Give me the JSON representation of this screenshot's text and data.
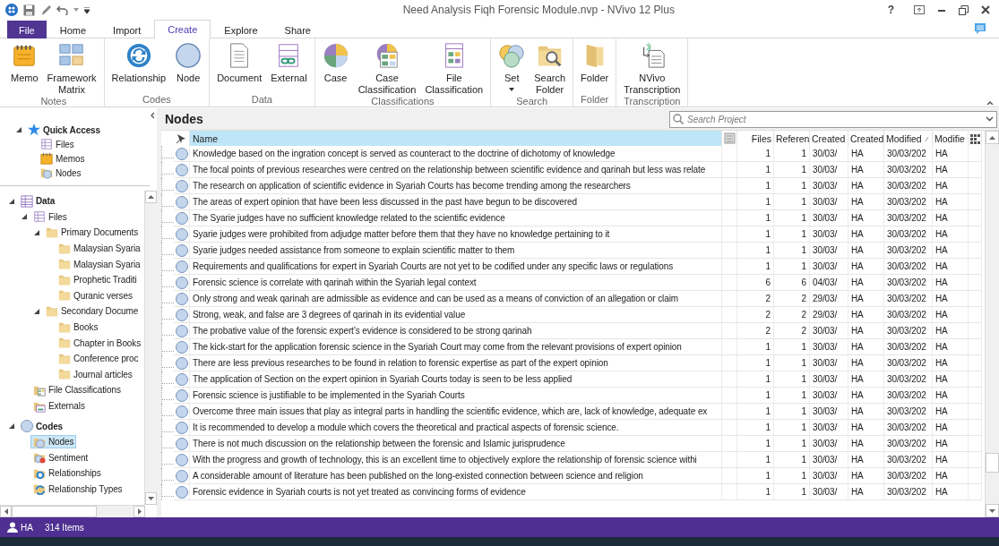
{
  "window": {
    "title": "Need Analysis Fiqh Forensic Module.nvp - NVivo 12 Plus",
    "help": "?"
  },
  "tabs": [
    {
      "label": "File",
      "kind": "file",
      "selected": false
    },
    {
      "label": "Home",
      "kind": "tab",
      "selected": false
    },
    {
      "label": "Import",
      "kind": "tab",
      "selected": false
    },
    {
      "label": "Create",
      "kind": "tab",
      "selected": true
    },
    {
      "label": "Explore",
      "kind": "tab",
      "selected": false
    },
    {
      "label": "Share",
      "kind": "tab",
      "selected": false
    }
  ],
  "ribbon": [
    {
      "label": "Notes",
      "buttons": [
        {
          "label": "Memo",
          "kind": "memo"
        },
        {
          "label": "Framework Matrix",
          "kind": "framework"
        }
      ]
    },
    {
      "label": "Codes",
      "buttons": [
        {
          "label": "Relationship",
          "kind": "relationship"
        },
        {
          "label": "Node",
          "kind": "node"
        }
      ]
    },
    {
      "label": "Data",
      "buttons": [
        {
          "label": "Document",
          "kind": "document"
        },
        {
          "label": "External",
          "kind": "external"
        }
      ]
    },
    {
      "label": "Classifications",
      "buttons": [
        {
          "label": "Case",
          "kind": "case"
        },
        {
          "label": "Case Classification",
          "kind": "caseclass"
        },
        {
          "label": "File Classification",
          "kind": "fileclass"
        }
      ]
    },
    {
      "label": "Search",
      "buttons": [
        {
          "label": "Set",
          "kind": "set",
          "dropdown": true
        },
        {
          "label": "Search Folder",
          "kind": "searchfolder"
        }
      ]
    },
    {
      "label": "Folder",
      "buttons": [
        {
          "label": "Folder",
          "kind": "folder"
        }
      ]
    },
    {
      "label": "Transcription",
      "buttons": [
        {
          "label": "NVivo Transcription",
          "kind": "transcription"
        }
      ]
    }
  ],
  "nav": {
    "quick_access": {
      "label": "Quick Access",
      "kind": "star",
      "expanded": true,
      "selected": false,
      "children": [
        {
          "label": "Files",
          "kind": "files",
          "selected": false
        },
        {
          "label": "Memos",
          "kind": "memos",
          "selected": false
        },
        {
          "label": "Nodes",
          "kind": "nodes",
          "selected": false
        }
      ]
    },
    "sections": [
      {
        "label": "Data",
        "kind": "data",
        "expanded": true,
        "selected": false,
        "children": [
          {
            "label": "Files",
            "kind": "files",
            "expanded": true,
            "selected": false,
            "children": [
              {
                "label": "Primary Documents",
                "kind": "folder",
                "expanded": true,
                "selected": false,
                "children": [
                  {
                    "label": "Malaysian Syaria",
                    "kind": "folder",
                    "selected": false
                  },
                  {
                    "label": "Malaysian Syaria",
                    "kind": "folder",
                    "selected": false
                  },
                  {
                    "label": "Prophetic Traditi",
                    "kind": "folder",
                    "selected": false
                  },
                  {
                    "label": "Quranic verses",
                    "kind": "folder",
                    "selected": false
                  }
                ]
              },
              {
                "label": "Secondary Docume",
                "kind": "folder",
                "expanded": true,
                "selected": false,
                "children": [
                  {
                    "label": "Books",
                    "kind": "folder",
                    "selected": false
                  },
                  {
                    "label": "Chapter in Books",
                    "kind": "folder",
                    "selected": false
                  },
                  {
                    "label": "Conference proc",
                    "kind": "folder",
                    "selected": false
                  },
                  {
                    "label": "Journal articles",
                    "kind": "folder",
                    "selected": false
                  }
                ]
              }
            ]
          },
          {
            "label": "File Classifications",
            "kind": "fileclass",
            "selected": false
          },
          {
            "label": "Externals",
            "kind": "externals",
            "selected": false
          }
        ]
      },
      {
        "label": "Codes",
        "kind": "codes",
        "expanded": true,
        "selected": false,
        "children": [
          {
            "label": "Nodes",
            "kind": "nodes",
            "selected": true
          },
          {
            "label": "Sentiment",
            "kind": "sentiment",
            "selected": false
          },
          {
            "label": "Relationships",
            "kind": "relationships",
            "selected": false
          },
          {
            "label": "Relationship Types",
            "kind": "reltypes",
            "selected": false
          }
        ]
      }
    ]
  },
  "list": {
    "title": "Nodes",
    "search": {
      "placeholder": "Search Project"
    },
    "columns": [
      {
        "label": "Name",
        "selected": true,
        "sorted": false
      },
      {
        "label": "Files",
        "selected": false,
        "sorted": false
      },
      {
        "label": "Referen",
        "selected": false,
        "sorted": false
      },
      {
        "label": "Created",
        "selected": false,
        "sorted": false
      },
      {
        "label": "Created",
        "selected": false,
        "sorted": false
      },
      {
        "label": "Modified",
        "selected": false,
        "sorted": true
      },
      {
        "label": "Modifie",
        "selected": false,
        "sorted": false
      }
    ],
    "rows": [
      [
        "Knowledge based on the ingration concept is served as counteract to the doctrine of dichotomy of knowledge",
        "1",
        "1",
        "30/03/",
        "HA",
        "30/03/202",
        "HA"
      ],
      [
        "The focal points of previous researches were centred on the relationship between scientific evidence and qarinah but less was relate",
        "1",
        "1",
        "30/03/",
        "HA",
        "30/03/202",
        "HA"
      ],
      [
        "The research on application of scientific evidence in Syariah Courts has become trending among the researchers",
        "1",
        "1",
        "30/03/",
        "HA",
        "30/03/202",
        "HA"
      ],
      [
        "The areas of expert opinion that have been less discussed in the past have begun to be discovered",
        "1",
        "1",
        "30/03/",
        "HA",
        "30/03/202",
        "HA"
      ],
      [
        "The Syarie judges have no sufficient knowledge related to the scientific evidence",
        "1",
        "1",
        "30/03/",
        "HA",
        "30/03/202",
        "HA"
      ],
      [
        "Syarie judges were prohibited from adjudge matter before them that they have no knowledge pertaining to it",
        "1",
        "1",
        "30/03/",
        "HA",
        "30/03/202",
        "HA"
      ],
      [
        "Syarie judges needed assistance from someone to explain scientific  matter to them",
        "1",
        "1",
        "30/03/",
        "HA",
        "30/03/202",
        "HA"
      ],
      [
        "Requirements and qualifications for expert in Syariah Courts are not yet to be codified under any specific laws or regulations",
        "1",
        "1",
        "30/03/",
        "HA",
        "30/03/202",
        "HA"
      ],
      [
        "Forensic science is correlate with qarinah within the Syariah legal context",
        "6",
        "6",
        "04/03/",
        "HA",
        "30/03/202",
        "HA"
      ],
      [
        "Only strong and weak qarinah are admissible as evidence and can be used as a means of conviction of an allegation or claim",
        "2",
        "2",
        "29/03/",
        "HA",
        "30/03/202",
        "HA"
      ],
      [
        "Strong, weak, and false are 3 degrees of qarinah in its evidential value",
        "2",
        "2",
        "29/03/",
        "HA",
        "30/03/202",
        "HA"
      ],
      [
        "The probative value of the forensic expert’s evidence is considered to be strong qarinah",
        "2",
        "2",
        "30/03/",
        "HA",
        "30/03/202",
        "HA"
      ],
      [
        "The kick-start for the application forensic science in the Syariah Court may come from the relevant provisions of expert opinion",
        "1",
        "1",
        "30/03/",
        "HA",
        "30/03/202",
        "HA"
      ],
      [
        "There are less previous researches to be found in relation to forensic expertise as part of the expert opinion",
        "1",
        "1",
        "30/03/",
        "HA",
        "30/03/202",
        "HA"
      ],
      [
        "The application of Section on the expert opinion in Syariah Courts today is seen to be less applied",
        "1",
        "1",
        "30/03/",
        "HA",
        "30/03/202",
        "HA"
      ],
      [
        "Forensic science is justifiable to be implemented in the Syariah Courts",
        "1",
        "1",
        "30/03/",
        "HA",
        "30/03/202",
        "HA"
      ],
      [
        "Overcome three main issues that play as integral parts in handling the scientific evidence, which are, lack of knowledge, adequate ex",
        "1",
        "1",
        "30/03/",
        "HA",
        "30/03/202",
        "HA"
      ],
      [
        "It is recommended to develop a module which covers the theoretical and practical aspects of forensic science.",
        "1",
        "1",
        "30/03/",
        "HA",
        "30/03/202",
        "HA"
      ],
      [
        "There is not much discussion on the relationship between the forensic and Islamic jurisprudence",
        "1",
        "1",
        "30/03/",
        "HA",
        "30/03/202",
        "HA"
      ],
      [
        "With the progress and growth of technology, this is an excellent time to objectively explore the relationship of forensic science withi",
        "1",
        "1",
        "30/03/",
        "HA",
        "30/03/202",
        "HA"
      ],
      [
        "A considerable amount of literature has been published on the long-existed connection between science and religion",
        "1",
        "1",
        "30/03/",
        "HA",
        "30/03/202",
        "HA"
      ],
      [
        "Forensic evidence in Syariah courts is not yet treated as convincing forms of evidence",
        "1",
        "1",
        "30/03/",
        "HA",
        "30/03/202",
        "HA"
      ]
    ]
  },
  "status_bar": {
    "user": "HA",
    "count": "314 Items"
  }
}
